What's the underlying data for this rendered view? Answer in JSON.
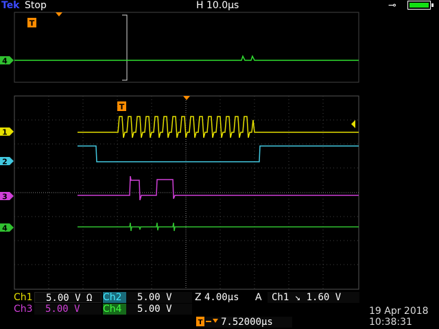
{
  "header": {
    "brand_prefix": "Tek",
    "run_state": "Stop",
    "horizontal_scale": "H 10.0µs",
    "power_icon": "plug-icon",
    "battery_icon": "battery-icon"
  },
  "channels": [
    {
      "id": "1",
      "label": "Ch1",
      "scale": "5.00 V",
      "coupling_symbol": "Ω",
      "color": "#e6e000"
    },
    {
      "id": "2",
      "label": "Ch2",
      "scale": "5.00 V",
      "color": "#42e8ff"
    },
    {
      "id": "3",
      "label": "Ch3",
      "scale": "5.00 V",
      "color": "#d040d8"
    },
    {
      "id": "4",
      "label": "Ch4",
      "scale": "5.00 V",
      "color": "#40ff40"
    }
  ],
  "zoom": {
    "label": "Z",
    "value": "4.00µs"
  },
  "trigger": {
    "mode": "A",
    "source": "Ch1",
    "slope_symbol": "↘",
    "level": "1.60 V",
    "marker": "T"
  },
  "trigger_position": {
    "value": "7.52000µs"
  },
  "datetime": {
    "date": "19 Apr 2018",
    "time": "10:38:31"
  }
}
